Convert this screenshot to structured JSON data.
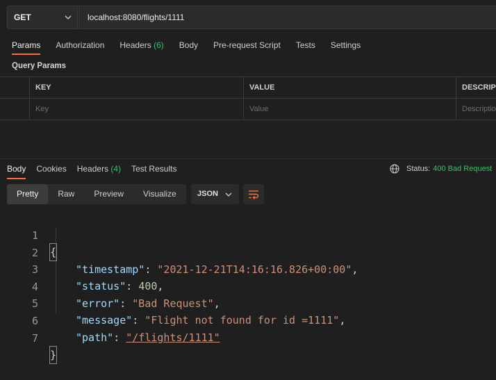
{
  "request": {
    "method": "GET",
    "url": "localhost:8080/flights/1111"
  },
  "req_tabs": [
    {
      "label": "Params"
    },
    {
      "label": "Authorization"
    },
    {
      "label": "Headers",
      "count": "(6)"
    },
    {
      "label": "Body"
    },
    {
      "label": "Pre-request Script"
    },
    {
      "label": "Tests"
    },
    {
      "label": "Settings"
    }
  ],
  "query_params": {
    "title": "Query Params",
    "columns": [
      "KEY",
      "VALUE",
      "DESCRIPTI"
    ],
    "placeholders": {
      "key": "Key",
      "value": "Value",
      "description": "Descriptio"
    }
  },
  "resp_tabs": [
    {
      "label": "Body"
    },
    {
      "label": "Cookies"
    },
    {
      "label": "Headers",
      "count": "(4)"
    },
    {
      "label": "Test Results"
    }
  ],
  "status": {
    "label": "Status:",
    "value": "400 Bad Request"
  },
  "view_modes": [
    "Pretty",
    "Raw",
    "Preview",
    "Visualize"
  ],
  "format": "JSON",
  "code": {
    "line_numbers": [
      "1",
      "2",
      "3",
      "4",
      "5",
      "6",
      "7"
    ],
    "open_brace": "{",
    "close_brace": "}",
    "fields": [
      {
        "key": "\"timestamp\"",
        "value": "\"2021-12-21T14:16:16.826+00:00\"",
        "type": "string",
        "comma": ","
      },
      {
        "key": "\"status\"",
        "value": "400",
        "type": "number",
        "comma": ","
      },
      {
        "key": "\"error\"",
        "value": "\"Bad Request\"",
        "type": "string",
        "comma": ","
      },
      {
        "key": "\"message\"",
        "value": "\"Flight not found for id =1111\"",
        "type": "string",
        "comma": ","
      },
      {
        "key": "\"path\"",
        "value": "\"/flights/1111\"",
        "type": "string",
        "comma": ""
      }
    ]
  },
  "colors": {
    "accent": "#ff6c37",
    "status_ok_green": "#3fbe6b",
    "json_key": "#9cdcfe",
    "json_string": "#ce9178",
    "json_number": "#b5cea8"
  }
}
